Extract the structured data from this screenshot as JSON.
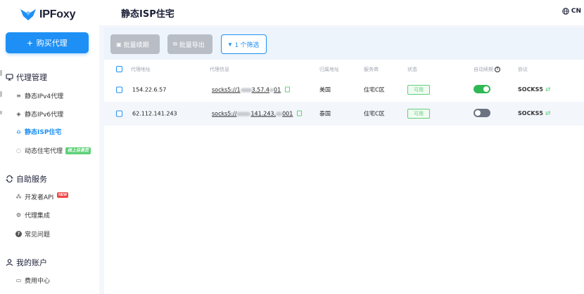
{
  "brand": {
    "name": "IPFoxy"
  },
  "sidebar": {
    "buy_label": "购买代理",
    "proxy_mgmt": {
      "label": "代理管理",
      "items": [
        {
          "label": "静态IPv4代理"
        },
        {
          "label": "静态IPv6代理"
        },
        {
          "label": "静态ISP住宅"
        },
        {
          "label": "动态住宅代理",
          "badge": "线上目录页"
        }
      ]
    },
    "self_service": {
      "label": "自助服务",
      "items": [
        {
          "label": "开发者API",
          "badge": "NEW"
        },
        {
          "label": "代理集成"
        },
        {
          "label": "常见问题"
        }
      ]
    },
    "account": {
      "label": "我的账户",
      "items": [
        {
          "label": "费用中心"
        }
      ]
    }
  },
  "header": {
    "title": "静态ISP住宅",
    "lang": "CN"
  },
  "toolbar": {
    "renew_label": "批量续期",
    "export_label": "批量导出",
    "filter_label": "1 个筛选"
  },
  "table": {
    "columns": [
      "代理地址",
      "代理信息",
      "归属地址",
      "服务商",
      "状态",
      "自动续期",
      "协议"
    ],
    "rows": [
      {
        "address": "154.22.6.57",
        "info_pre": "socks5://1",
        "info_mid": "3.57.4",
        "info_post": "01",
        "region": "美国",
        "provider": "住宅C区",
        "status": "可用",
        "auto_renew": true,
        "protocol": "SOCKS5"
      },
      {
        "address": "62.112.141.243",
        "info_pre": "socks5://",
        "info_mid": "141.243.",
        "info_post": "001",
        "region": "泰国",
        "provider": "住宅C区",
        "status": "可用",
        "auto_renew": false,
        "protocol": "SOCKS5"
      }
    ]
  },
  "colors": {
    "accent": "#1e90f5",
    "success": "#5fd07a",
    "toggle_on": "#2fb855",
    "toggle_off": "#6b7280"
  }
}
